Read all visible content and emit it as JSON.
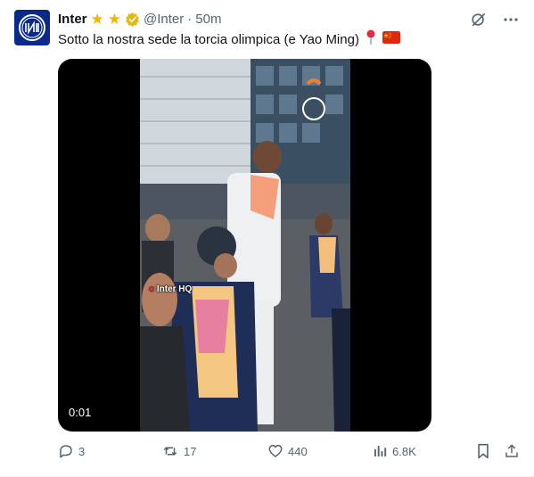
{
  "post": {
    "author_name": "Inter",
    "author_handle": "@Inter",
    "separator": "·",
    "time": "50m",
    "text": "Sotto la nostra sede la torcia olimpica (e Yao Ming)",
    "badges": [
      "star-icon",
      "star-icon",
      "verified-badge-icon"
    ],
    "emojis": [
      "round-pushpin-icon",
      "china-flag-icon"
    ]
  },
  "media": {
    "type": "video",
    "timestamp": "0:01",
    "overlay_text": "Inter HQ"
  },
  "actions": {
    "replies": "3",
    "reposts": "17",
    "likes": "440",
    "views": "6.8K"
  },
  "colors": {
    "text_primary": "#0f1419",
    "text_secondary": "#536471",
    "brand_navy": "#0a2a8a",
    "badge_gold": "#e2b719"
  }
}
